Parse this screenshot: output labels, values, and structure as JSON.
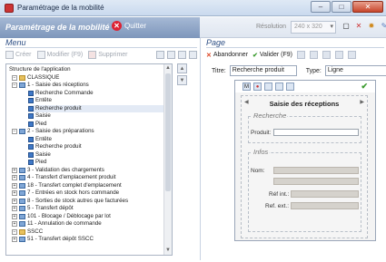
{
  "window": {
    "title": "Paramétrage de la mobilité"
  },
  "header": {
    "app_name": "Paramétrage de la mobilité",
    "quit_label": "Quitter"
  },
  "resolution": {
    "label": "Résolution",
    "value": "240 x 320"
  },
  "menu": {
    "title": "Menu",
    "actions": {
      "create": "Créer",
      "modify": "Modifier (F9)",
      "delete": "Supprimer"
    },
    "tree": [
      "Structure de l'application",
      "CLASSIQUE",
      "1 - Saisie des réceptions",
      "Recherche Commande",
      "Entête",
      "Recherche produit",
      "Saisie",
      "Pied",
      "2 - Saisie des préparations",
      "Entête",
      "Recherche produit",
      "Saisie",
      "Pied",
      "3 - Validation des chargements",
      "4 - Transfert d'emplacement produit",
      "18 - Transfert complet d'emplacement",
      "7 - Entrées en stock hors commande",
      "8 - Sorties de stock autres que facturées",
      "5 - Transfert dépôt",
      "101 - Blocage / Déblocage par lot",
      "11 - Annulation de commande",
      "SSCC",
      "51 - Transfert dépôt SSCC"
    ]
  },
  "page": {
    "title": "Page",
    "actions": {
      "cancel": "Abandonner",
      "validate": "Valider (F9)"
    },
    "form": {
      "title_label": "Titre:",
      "title_value": "Recherche produit",
      "type_label": "Type:",
      "type_value": "Ligne"
    },
    "preview": {
      "screen_title": "Saisie des réceptions",
      "group1": "Recherche",
      "field_produit": "Produit:",
      "group2": "Infos",
      "field_nom": "Nom:",
      "field_ref_int": "Réf int.:",
      "field_ref_ext": "Ref. ext.:"
    }
  }
}
